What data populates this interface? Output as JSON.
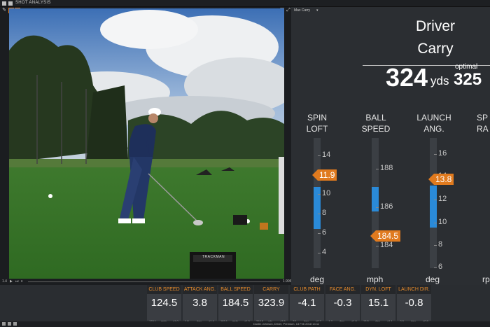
{
  "app": {
    "title": "SHOT ANALYSIS"
  },
  "video": {
    "time_start": "1.4",
    "time_end": "1.996",
    "screen_label": "TRACKMAN"
  },
  "right": {
    "dropdown": "Max Carry",
    "line1": "Driver",
    "line2": "Carry",
    "big_value": "324",
    "big_unit": "yds",
    "optimal_label": "optimal",
    "optimal_value": "325",
    "columns": [
      {
        "title1": "SPIN",
        "title2": "LOFT",
        "unit": "deg",
        "ticks": [
          "14",
          "12",
          "10",
          "8",
          "6",
          "4"
        ],
        "flag": "11.9"
      },
      {
        "title1": "BALL",
        "title2": "SPEED",
        "unit": "mph",
        "ticks": [
          "188",
          "186",
          "184"
        ],
        "flag": "184.5"
      },
      {
        "title1": "LAUNCH",
        "title2": "ANG.",
        "unit": "deg",
        "ticks": [
          "16",
          "14",
          "12",
          "10",
          "8",
          "6"
        ],
        "flag": "13.8"
      },
      {
        "title1": "SP",
        "title2": "RA",
        "unit": "rp",
        "ticks": [],
        "flag": ""
      }
    ]
  },
  "tiles": [
    {
      "label": "CLUB SPEED",
      "value": "124.5",
      "sub1": "123.1",
      "unit": "mph",
      "sub2": "±1.0"
    },
    {
      "label": "ATTACK ANG.",
      "value": "3.8",
      "sub1": "1.8",
      "unit": "deg",
      "sub2": "±1.4"
    },
    {
      "label": "BALL SPEED",
      "value": "184.5",
      "sub1": "183.1",
      "unit": "mph",
      "sub2": "±1.0"
    },
    {
      "label": "CARRY",
      "value": "323.9",
      "sub1": "318.9",
      "unit": "yds",
      "sub2": "±3.5"
    },
    {
      "label": "CLUB PATH",
      "value": "-4.1",
      "sub1": "-3.1",
      "unit": "deg",
      "sub2": "±0.7"
    },
    {
      "label": "FACE ANG.",
      "value": "-0.3",
      "sub1": "-1.7",
      "unit": "deg",
      "sub2": "±1.0"
    },
    {
      "label": "DYN. LOFT",
      "value": "15.1",
      "sub1": "13.5",
      "unit": "deg",
      "sub2": "±1.1"
    },
    {
      "label": "LAUNCH DIR.",
      "value": "-0.8",
      "sub1": "-2.0",
      "unit": "deg",
      "sub2": "±0.9"
    }
  ],
  "status": {
    "text": "Dustin Johnson, Driver, Premium, 13 Feb 2018 14:11"
  },
  "colors": {
    "accent": "#e07a1e",
    "range": "#2a8ad8",
    "panel": "#2b2e32"
  }
}
